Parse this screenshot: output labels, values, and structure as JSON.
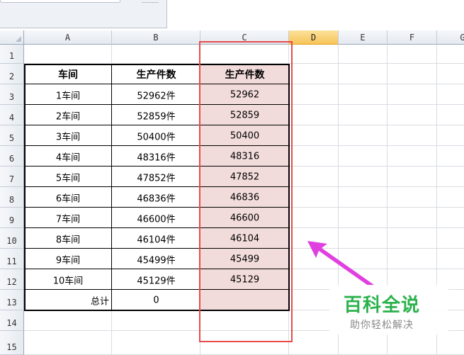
{
  "columns": [
    "A",
    "B",
    "C",
    "D",
    "E",
    "F",
    "G"
  ],
  "selected_column": "D",
  "rows": [
    "1",
    "2",
    "3",
    "4",
    "5",
    "6",
    "7",
    "8",
    "9",
    "10",
    "11",
    "12",
    "13",
    "14",
    "15"
  ],
  "table": {
    "headers": [
      "车间",
      "生产件数",
      "生产件数"
    ],
    "data": [
      [
        "1车间",
        "52962件",
        "52962"
      ],
      [
        "2车间",
        "52859件",
        "52859"
      ],
      [
        "3车间",
        "50400件",
        "50400"
      ],
      [
        "4车间",
        "48316件",
        "48316"
      ],
      [
        "5车间",
        "47852件",
        "47852"
      ],
      [
        "6车间",
        "46836件",
        "46836"
      ],
      [
        "7车间",
        "46600件",
        "46600"
      ],
      [
        "8车间",
        "46104件",
        "46104"
      ],
      [
        "9车间",
        "45499件",
        "45499"
      ],
      [
        "10车间",
        "45129件",
        "45129"
      ]
    ],
    "total_label": "总计",
    "total_value": "0",
    "total_c": ""
  },
  "highlight_color": "#f2dcdb",
  "annotation_color": "#e84a4a",
  "arrow_color": "#e040e0",
  "watermark": {
    "title": "百科全说",
    "subtitle": "助你轻松解决",
    "title_color": "#2bb24c"
  }
}
